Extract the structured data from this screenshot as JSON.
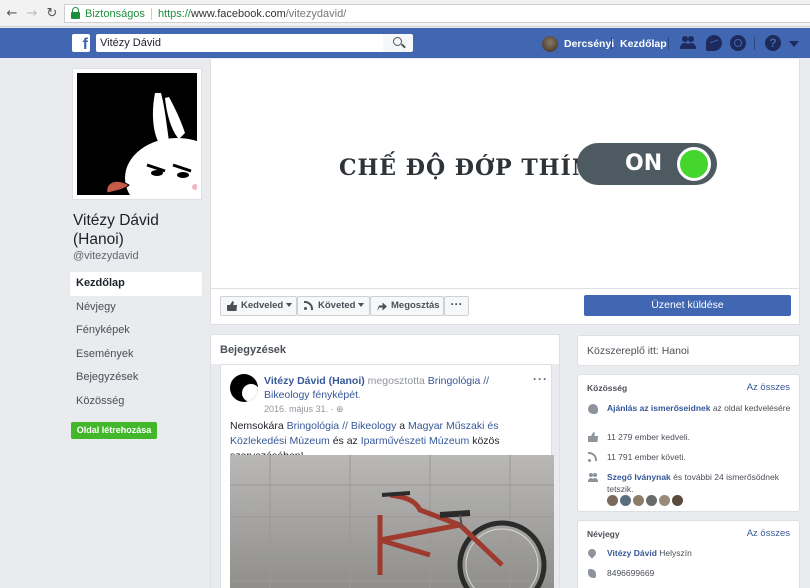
{
  "browser": {
    "secure_label": "Biztonságos",
    "url_scheme": "https://",
    "url_host": "www.facebook.com",
    "url_path": "/vitezydavid/",
    "back_icon": "arrow-left",
    "forward_icon": "arrow-right",
    "reload_icon": "reload"
  },
  "topbar": {
    "search_value": "Vitézy Dávid",
    "user_name": "Dercsényi",
    "home_label": "Kezdőlap",
    "logo_letter": "f",
    "help_glyph": "?"
  },
  "profile": {
    "name": "Vitézy Dávid (Hanoi)",
    "handle": "@vitezydavid"
  },
  "left_nav": {
    "items": [
      {
        "label": "Kezdőlap",
        "active": true
      },
      {
        "label": "Névjegy",
        "active": false
      },
      {
        "label": "Fényképek",
        "active": false
      },
      {
        "label": "Események",
        "active": false
      },
      {
        "label": "Bejegyzések",
        "active": false
      },
      {
        "label": "Közösség",
        "active": false
      }
    ],
    "create_page": "Oldal létrehozása"
  },
  "cover": {
    "text": "CHẾ ĐỘ ĐỚP THÍNH",
    "toggle_text": "ON",
    "toggle_color": "#44d62c"
  },
  "actions": {
    "like": "Kedveled",
    "follow": "Követed",
    "share": "Megosztás",
    "more": "···",
    "message": "Üzenet küldése"
  },
  "posts": {
    "header": "Bejegyzések",
    "post": {
      "author": "Vitézy Dávid (Hanoi)",
      "shared_text": " megosztotta ",
      "shared_page": "Bringológia // Bikeology",
      "shared_suffix_link": " fényképét",
      "shared_end": ".",
      "date": "2016. május 31. · ⊕",
      "body_prefix": "Nemsokára ",
      "body_link1": "Bringológia // Bikeology",
      "body_mid1": " a ",
      "body_link2": "Magyar Műszaki és Közlekedési Múzeum",
      "body_mid2": " és az ",
      "body_link3": "Iparművészeti Múzeum",
      "body_end": " közös szervezésében!",
      "options": "···"
    }
  },
  "right": {
    "hanoi": "Közszereplő itt: Hanoi",
    "community": {
      "title": "Közösség",
      "see_all": "Az összes",
      "invite_link": "Ajánlás az ismerőseidnek",
      "invite_rest": " az oldal kedvelésére",
      "likes": "11 279 ember kedveli.",
      "follows": "11 791 ember követi.",
      "friend_link": "Szegő Iványnak",
      "friend_rest": " és további 24 ismerősödnek tetszik."
    },
    "about": {
      "title": "Névjegy",
      "see_all": "Az összes",
      "location_link": "Vitézy Dávid",
      "location_rest": " Helyszín",
      "phone": "8496699669"
    }
  },
  "colors": {
    "fb_blue": "#4267b2",
    "link": "#365899",
    "green": "#42b72a"
  }
}
